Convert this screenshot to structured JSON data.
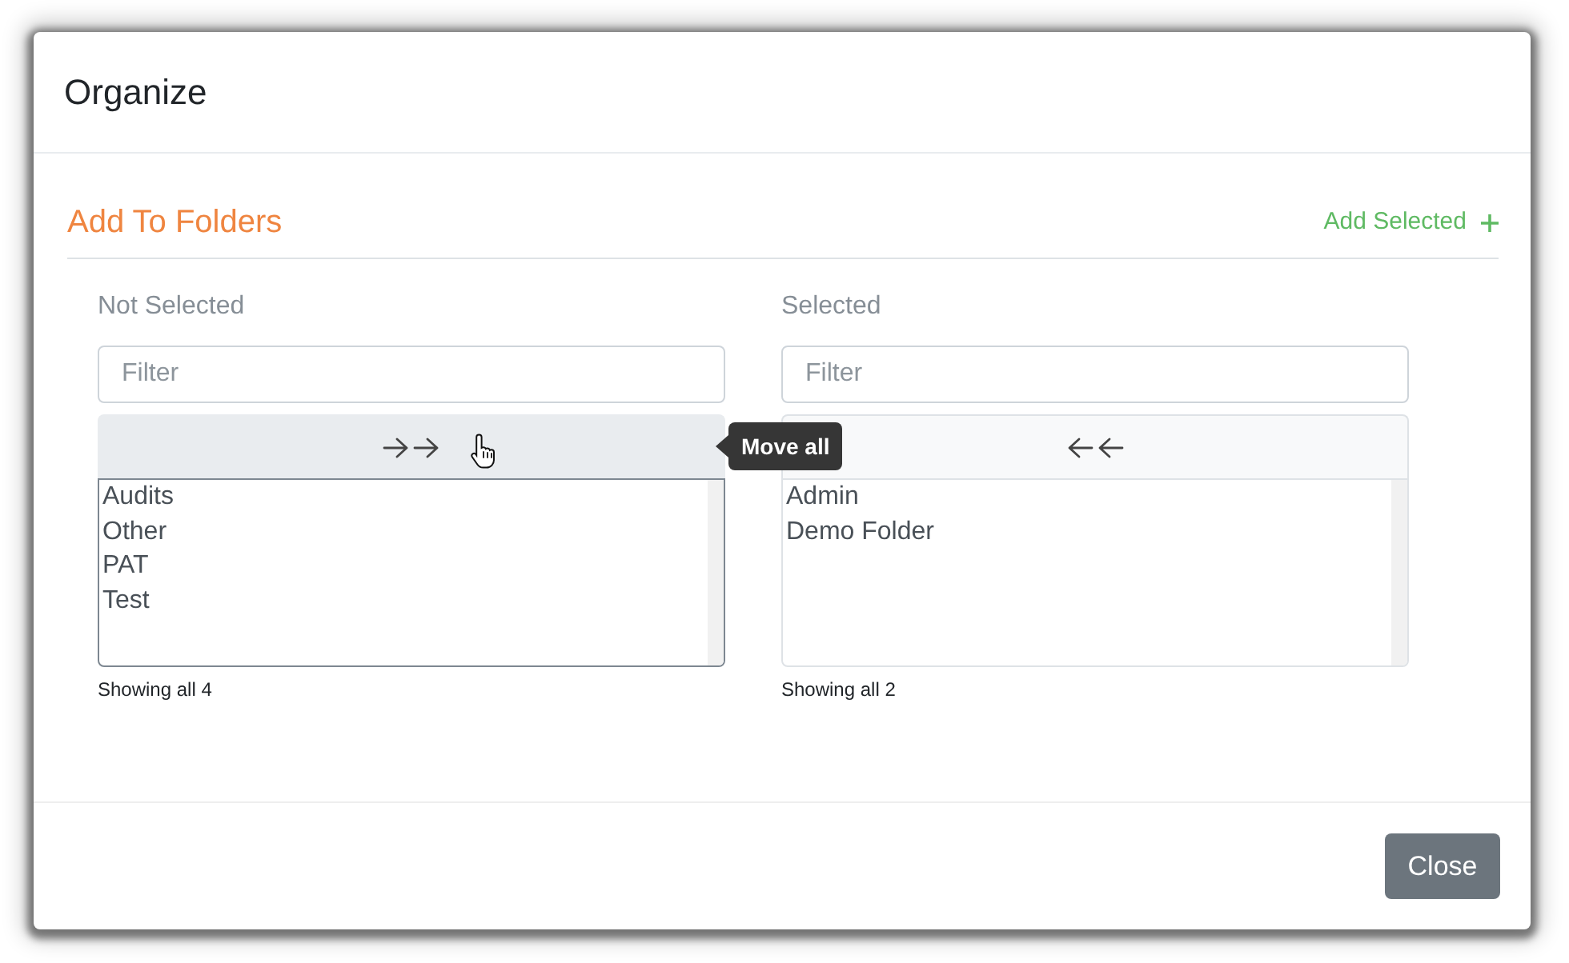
{
  "dialog": {
    "title": "Organize"
  },
  "section": {
    "title": "Add To Folders",
    "action": {
      "label": "Add Selected"
    }
  },
  "panels": [
    {
      "label": "Not Selected",
      "filter": {
        "placeholder": "Filter"
      },
      "move_all": {
        "kind": "right",
        "hovered": true,
        "tooltip": "Move all"
      },
      "list": {
        "focused": true,
        "items": [
          {
            "label": "Audits",
            "selected": false
          },
          {
            "label": "Other",
            "selected": false
          },
          {
            "label": "PAT",
            "selected": false
          },
          {
            "label": "Test",
            "selected": false
          }
        ]
      },
      "info": "Showing all 4"
    },
    {
      "label": "Selected",
      "filter": {
        "placeholder": "Filter"
      },
      "move_all": {
        "kind": "left",
        "hovered": false
      },
      "list": {
        "focused": false,
        "items": [
          {
            "label": "Admin",
            "selected": false
          },
          {
            "label": "Demo Folder",
            "selected": false
          }
        ]
      },
      "info": "Showing all 2"
    }
  ],
  "footer": {
    "buttons": [
      {
        "label": "Close"
      }
    ]
  }
}
